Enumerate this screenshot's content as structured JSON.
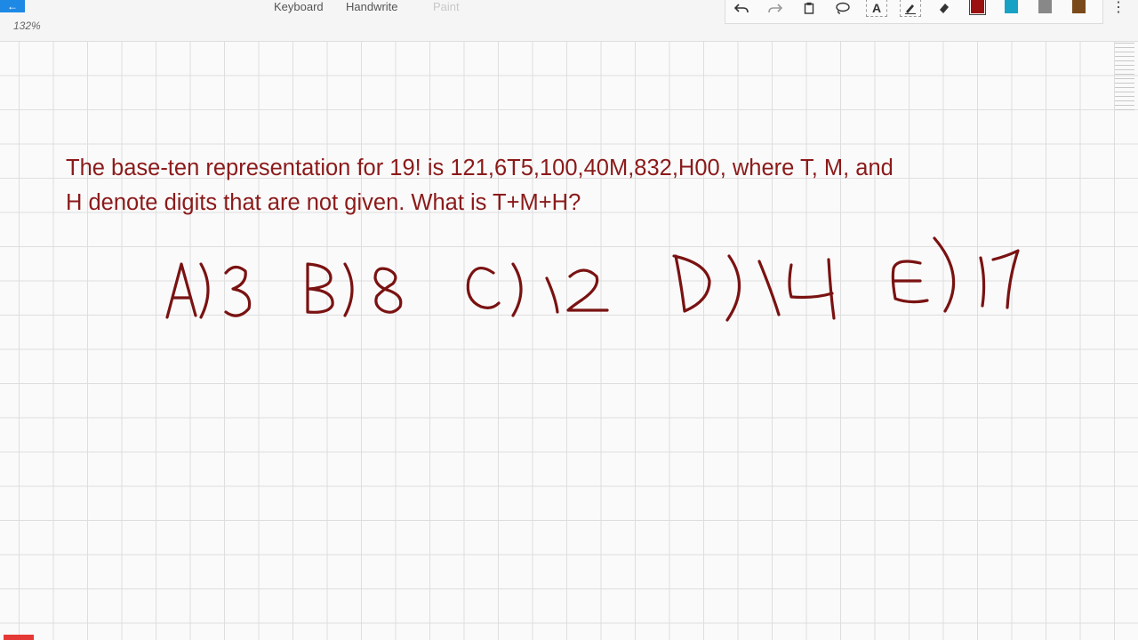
{
  "app": {
    "zoom_label": "132%",
    "mode_tabs": [
      {
        "label": "Keyboard"
      },
      {
        "label": "Handwrite"
      },
      {
        "label": "Paint"
      }
    ],
    "tools": {
      "text_tool_glyph": "A",
      "colors": [
        "#9b1111",
        "#17a2c5",
        "#888888",
        "#7a4a1a"
      ]
    }
  },
  "document": {
    "problem_line1": "The base-ten representation for 19! is 121,6T5,100,40M,832,H00, where T, M, and",
    "problem_line2": "H denote digits that are not given. What is T+M+H?",
    "answer_choices": [
      "A)3",
      "B)8",
      "C)12",
      "D)14",
      "E)17"
    ]
  }
}
